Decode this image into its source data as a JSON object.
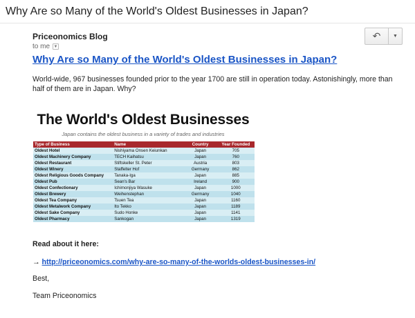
{
  "subject": "Why Are so Many of the World's Oldest Businesses in Japan?",
  "sender": "Priceonomics Blog",
  "to_label": "to me",
  "icons": {
    "reply": "reply-icon",
    "more": "dropdown-arrow-icon",
    "to_dropdown": "dropdown-arrow-icon"
  },
  "headline": "Why Are so Many of the World's Oldest Businesses in Japan?",
  "intro": "World-wide, 967 businesses founded prior to the year 1700 are still in operation today. Astonishingly, more than half of them are in Japan. Why?",
  "infographic": {
    "title": "The World's Oldest Businesses",
    "subtitle": "Japan contains the oldest business in a variety of trades and industries",
    "headers": [
      "Type of Business",
      "Name",
      "Country",
      "Year Founded"
    ],
    "header_color": "#a8282c",
    "rows": [
      [
        "Oldest Hotel",
        "Nishiyama Onsen Keiunkan",
        "Japan",
        "705"
      ],
      [
        "Oldest Machinery Company",
        "TECH Kaihatsu",
        "Japan",
        "760"
      ],
      [
        "Oldest Restaurant",
        "Stiftskeller St. Peter",
        "Austria",
        "803"
      ],
      [
        "Oldest Winery",
        "Staffelter Hof",
        "Germany",
        "862"
      ],
      [
        "Oldest Religious Goods Company",
        "Tanaka-Iga",
        "Japan",
        "885"
      ],
      [
        "Oldest Pub",
        "Sean's Bar",
        "Ireland",
        "900"
      ],
      [
        "Oldest Confectionary",
        "Ichimonjiya Wasuke",
        "Japan",
        "1000"
      ],
      [
        "Oldest Brewery",
        "Weihenstephan",
        "Germany",
        "1040"
      ],
      [
        "Oldest Tea Company",
        "Tsuen Tea",
        "Japan",
        "1160"
      ],
      [
        "Oldest Metalwork Company",
        "Ito Tekko",
        "Japan",
        "1189"
      ],
      [
        "Oldest Sake Company",
        "Sudo Honke",
        "Japan",
        "1141"
      ],
      [
        "Oldest Pharmacy",
        "Sankogan",
        "Japan",
        "1319"
      ]
    ]
  },
  "read_label": "Read about it here:",
  "arrow": "→",
  "link": "http://priceonomics.com/why-are-so-many-of-the-worlds-oldest-businesses-in/",
  "closing": "Best,",
  "signature": "Team Priceonomics",
  "colors": {
    "link": "#1a55c6"
  }
}
